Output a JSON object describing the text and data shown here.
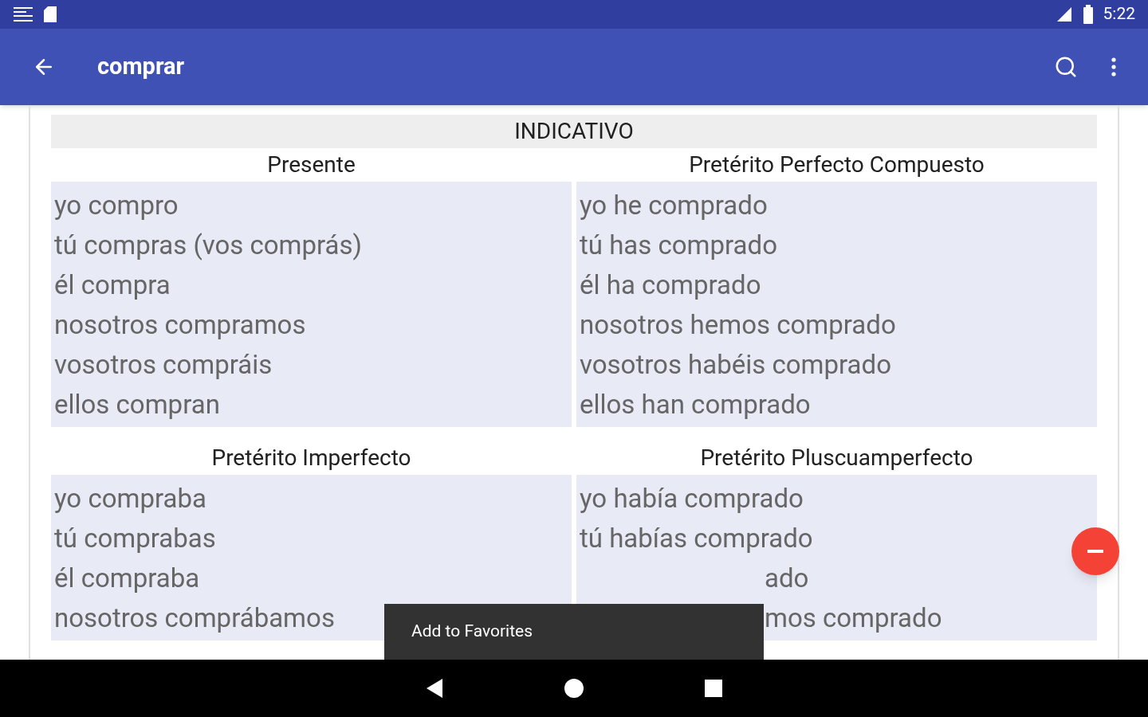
{
  "status_bar": {
    "time": "5:22"
  },
  "toolbar": {
    "title": "comprar"
  },
  "section": "INDICATIVO",
  "tenses": [
    {
      "name": "Presente",
      "forms": [
        {
          "text": "yo compro",
          "kind": "full"
        },
        {
          "text": "tú compras (vos comprás)",
          "kind": "full"
        },
        {
          "text": "él compra",
          "kind": "full"
        },
        {
          "text": "nosotros compramos",
          "kind": "full"
        },
        {
          "text": "vosotros compráis",
          "kind": "full"
        },
        {
          "text": "ellos compran",
          "kind": "full"
        }
      ]
    },
    {
      "name": "Pretérito Perfecto Compuesto",
      "forms": [
        {
          "text": "yo he comprado",
          "kind": "full"
        },
        {
          "text": "tú has comprado",
          "kind": "full"
        },
        {
          "text": "él ha comprado",
          "kind": "full"
        },
        {
          "text": "nosotros hemos comprado",
          "kind": "full"
        },
        {
          "text": "vosotros habéis comprado",
          "kind": "full"
        },
        {
          "text": "ellos han comprado",
          "kind": "full"
        }
      ]
    },
    {
      "name": "Pretérito Imperfecto",
      "forms": [
        {
          "text": "yo compraba",
          "kind": "full"
        },
        {
          "text": "tú comprabas",
          "kind": "full"
        },
        {
          "text": "él compraba",
          "kind": "full"
        },
        {
          "text": "nosotros comprábamos",
          "kind": "full"
        }
      ]
    },
    {
      "name": "Pretérito Pluscuamperfecto",
      "forms": [
        {
          "text": "yo había comprado",
          "kind": "full"
        },
        {
          "text": "tú habías comprado",
          "kind": "full"
        },
        {
          "text": "ado",
          "kind": "partial"
        },
        {
          "text": "mos comprado",
          "kind": "partial"
        }
      ]
    }
  ],
  "toast": "Add to Favorites"
}
